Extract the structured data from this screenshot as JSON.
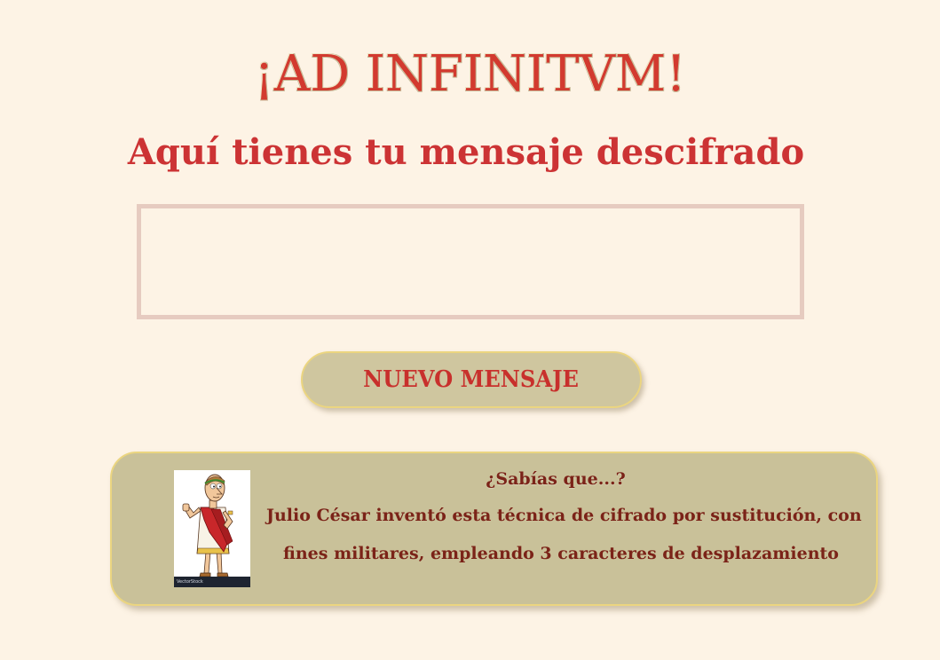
{
  "header": {
    "title": "¡AD INFINITVM!",
    "subtitle": "Aquí tienes tu mensaje descifrado"
  },
  "message": {
    "value": ""
  },
  "actions": {
    "new_message_label": "NUEVO MENSAJE"
  },
  "fact": {
    "title": "¿Sabías que...?",
    "line1": "Julio César inventó esta técnica de cifrado por sustitución, con",
    "line2": "fines militares, empleando 3 caracteres de desplazamiento",
    "image_credit": "VectorStock"
  },
  "colors": {
    "background": "#fdf3e5",
    "title_red": "#d23a2f",
    "button_fill": "#cfc69f",
    "panel_fill": "#c9c199",
    "panel_text": "#7b2318",
    "border_gold": "#ebd580"
  }
}
